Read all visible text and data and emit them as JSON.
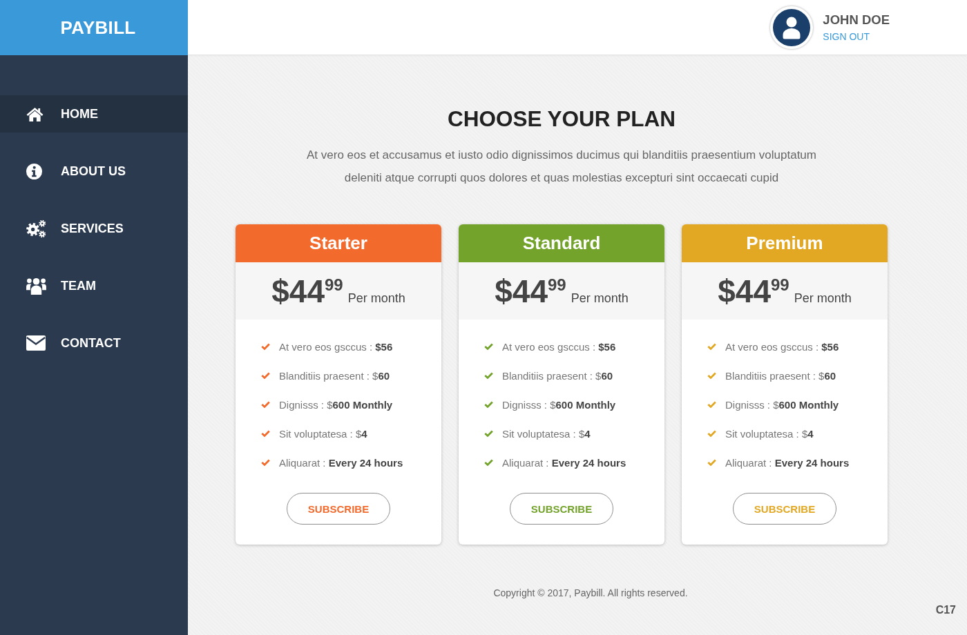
{
  "brand": {
    "logo": "PAYBILL"
  },
  "user": {
    "name": "JOHN DOE",
    "action": "SIGN OUT"
  },
  "sidebar": {
    "items": [
      {
        "label": "HOME",
        "selected": true
      },
      {
        "label": "ABOUT US",
        "selected": false
      },
      {
        "label": "SERVICES",
        "selected": false
      },
      {
        "label": "TEAM",
        "selected": false
      },
      {
        "label": "CONTACT",
        "selected": false
      }
    ]
  },
  "hero": {
    "title": "CHOOSE YOUR PLAN",
    "text": "At vero eos et accusamus et iusto odio dignissimos ducimus qui blanditiis praesentium voluptatum deleniti atque corrupti quos dolores et quas molestias excepturi sint occaecati cupid"
  },
  "plans": [
    {
      "name": "Starter",
      "color": "#f26a2c",
      "price": {
        "amount": "$44",
        "cents": "99",
        "period": "Per month"
      },
      "features": [
        "At vero eos gsccus : **$56**",
        "Blanditiis praesent : $**60**",
        "Dignisss : $**600 Monthly**",
        "Sit voluptatesa : $**4**",
        "Aliquarat : **Every 24 hours**"
      ],
      "button": "SUBSCRIBE"
    },
    {
      "name": "Standard",
      "color": "#73a32b",
      "price": {
        "amount": "$44",
        "cents": "99",
        "period": "Per month"
      },
      "features": [
        "At vero eos gsccus : **$56**",
        "Blanditiis praesent : $**60**",
        "Dignisss : $**600 Monthly**",
        "Sit voluptatesa : $**4**",
        "Aliquarat : **Every 24 hours**"
      ],
      "button": "SUBSCRIBE"
    },
    {
      "name": "Premium",
      "color": "#e2a823",
      "price": {
        "amount": "$44",
        "cents": "99",
        "period": "Per month"
      },
      "features": [
        "At vero eos gsccus : **$56**",
        "Blanditiis praesent : $**60**",
        "Dignisss : $**600 Monthly**",
        "Sit voluptatesa : $**4**",
        "Aliquarat : **Every 24 hours**"
      ],
      "button": "SUBSCRIBE"
    }
  ],
  "footer": {
    "copyright": "Copyright © 2017, Paybill. All rights reserved.",
    "code": "C17"
  }
}
